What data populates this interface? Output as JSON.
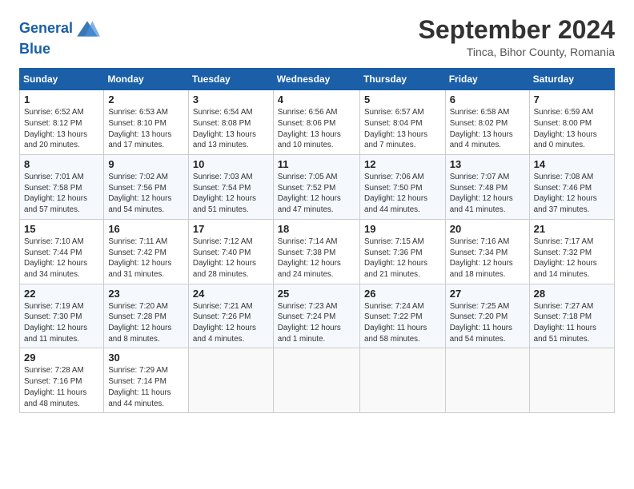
{
  "header": {
    "logo_line1": "General",
    "logo_line2": "Blue",
    "month": "September 2024",
    "location": "Tinca, Bihor County, Romania"
  },
  "weekdays": [
    "Sunday",
    "Monday",
    "Tuesday",
    "Wednesday",
    "Thursday",
    "Friday",
    "Saturday"
  ],
  "weeks": [
    [
      {
        "day": "1",
        "sunrise": "Sunrise: 6:52 AM",
        "sunset": "Sunset: 8:12 PM",
        "daylight": "Daylight: 13 hours and 20 minutes."
      },
      {
        "day": "2",
        "sunrise": "Sunrise: 6:53 AM",
        "sunset": "Sunset: 8:10 PM",
        "daylight": "Daylight: 13 hours and 17 minutes."
      },
      {
        "day": "3",
        "sunrise": "Sunrise: 6:54 AM",
        "sunset": "Sunset: 8:08 PM",
        "daylight": "Daylight: 13 hours and 13 minutes."
      },
      {
        "day": "4",
        "sunrise": "Sunrise: 6:56 AM",
        "sunset": "Sunset: 8:06 PM",
        "daylight": "Daylight: 13 hours and 10 minutes."
      },
      {
        "day": "5",
        "sunrise": "Sunrise: 6:57 AM",
        "sunset": "Sunset: 8:04 PM",
        "daylight": "Daylight: 13 hours and 7 minutes."
      },
      {
        "day": "6",
        "sunrise": "Sunrise: 6:58 AM",
        "sunset": "Sunset: 8:02 PM",
        "daylight": "Daylight: 13 hours and 4 minutes."
      },
      {
        "day": "7",
        "sunrise": "Sunrise: 6:59 AM",
        "sunset": "Sunset: 8:00 PM",
        "daylight": "Daylight: 13 hours and 0 minutes."
      }
    ],
    [
      {
        "day": "8",
        "sunrise": "Sunrise: 7:01 AM",
        "sunset": "Sunset: 7:58 PM",
        "daylight": "Daylight: 12 hours and 57 minutes."
      },
      {
        "day": "9",
        "sunrise": "Sunrise: 7:02 AM",
        "sunset": "Sunset: 7:56 PM",
        "daylight": "Daylight: 12 hours and 54 minutes."
      },
      {
        "day": "10",
        "sunrise": "Sunrise: 7:03 AM",
        "sunset": "Sunset: 7:54 PM",
        "daylight": "Daylight: 12 hours and 51 minutes."
      },
      {
        "day": "11",
        "sunrise": "Sunrise: 7:05 AM",
        "sunset": "Sunset: 7:52 PM",
        "daylight": "Daylight: 12 hours and 47 minutes."
      },
      {
        "day": "12",
        "sunrise": "Sunrise: 7:06 AM",
        "sunset": "Sunset: 7:50 PM",
        "daylight": "Daylight: 12 hours and 44 minutes."
      },
      {
        "day": "13",
        "sunrise": "Sunrise: 7:07 AM",
        "sunset": "Sunset: 7:48 PM",
        "daylight": "Daylight: 12 hours and 41 minutes."
      },
      {
        "day": "14",
        "sunrise": "Sunrise: 7:08 AM",
        "sunset": "Sunset: 7:46 PM",
        "daylight": "Daylight: 12 hours and 37 minutes."
      }
    ],
    [
      {
        "day": "15",
        "sunrise": "Sunrise: 7:10 AM",
        "sunset": "Sunset: 7:44 PM",
        "daylight": "Daylight: 12 hours and 34 minutes."
      },
      {
        "day": "16",
        "sunrise": "Sunrise: 7:11 AM",
        "sunset": "Sunset: 7:42 PM",
        "daylight": "Daylight: 12 hours and 31 minutes."
      },
      {
        "day": "17",
        "sunrise": "Sunrise: 7:12 AM",
        "sunset": "Sunset: 7:40 PM",
        "daylight": "Daylight: 12 hours and 28 minutes."
      },
      {
        "day": "18",
        "sunrise": "Sunrise: 7:14 AM",
        "sunset": "Sunset: 7:38 PM",
        "daylight": "Daylight: 12 hours and 24 minutes."
      },
      {
        "day": "19",
        "sunrise": "Sunrise: 7:15 AM",
        "sunset": "Sunset: 7:36 PM",
        "daylight": "Daylight: 12 hours and 21 minutes."
      },
      {
        "day": "20",
        "sunrise": "Sunrise: 7:16 AM",
        "sunset": "Sunset: 7:34 PM",
        "daylight": "Daylight: 12 hours and 18 minutes."
      },
      {
        "day": "21",
        "sunrise": "Sunrise: 7:17 AM",
        "sunset": "Sunset: 7:32 PM",
        "daylight": "Daylight: 12 hours and 14 minutes."
      }
    ],
    [
      {
        "day": "22",
        "sunrise": "Sunrise: 7:19 AM",
        "sunset": "Sunset: 7:30 PM",
        "daylight": "Daylight: 12 hours and 11 minutes."
      },
      {
        "day": "23",
        "sunrise": "Sunrise: 7:20 AM",
        "sunset": "Sunset: 7:28 PM",
        "daylight": "Daylight: 12 hours and 8 minutes."
      },
      {
        "day": "24",
        "sunrise": "Sunrise: 7:21 AM",
        "sunset": "Sunset: 7:26 PM",
        "daylight": "Daylight: 12 hours and 4 minutes."
      },
      {
        "day": "25",
        "sunrise": "Sunrise: 7:23 AM",
        "sunset": "Sunset: 7:24 PM",
        "daylight": "Daylight: 12 hours and 1 minute."
      },
      {
        "day": "26",
        "sunrise": "Sunrise: 7:24 AM",
        "sunset": "Sunset: 7:22 PM",
        "daylight": "Daylight: 11 hours and 58 minutes."
      },
      {
        "day": "27",
        "sunrise": "Sunrise: 7:25 AM",
        "sunset": "Sunset: 7:20 PM",
        "daylight": "Daylight: 11 hours and 54 minutes."
      },
      {
        "day": "28",
        "sunrise": "Sunrise: 7:27 AM",
        "sunset": "Sunset: 7:18 PM",
        "daylight": "Daylight: 11 hours and 51 minutes."
      }
    ],
    [
      {
        "day": "29",
        "sunrise": "Sunrise: 7:28 AM",
        "sunset": "Sunset: 7:16 PM",
        "daylight": "Daylight: 11 hours and 48 minutes."
      },
      {
        "day": "30",
        "sunrise": "Sunrise: 7:29 AM",
        "sunset": "Sunset: 7:14 PM",
        "daylight": "Daylight: 11 hours and 44 minutes."
      },
      null,
      null,
      null,
      null,
      null
    ]
  ]
}
